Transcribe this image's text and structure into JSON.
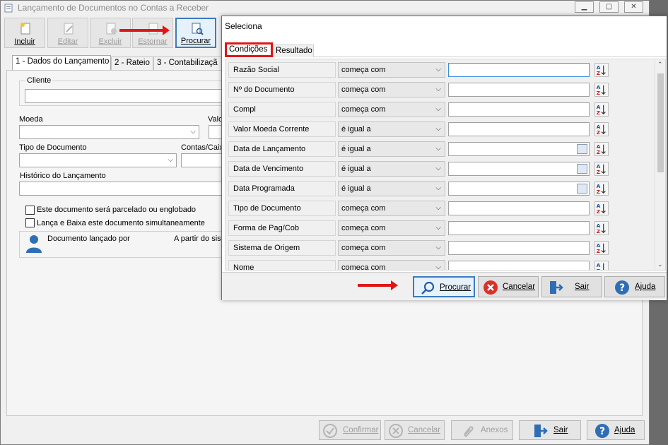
{
  "main_window": {
    "title": "Lançamento de Documentos no Contas a Receber",
    "toolbar": [
      {
        "label": "Incluir",
        "icon": "new-document-icon",
        "enabled": true
      },
      {
        "label": "Editar",
        "icon": "edit-document-icon",
        "enabled": false
      },
      {
        "label": "Excluir",
        "icon": "delete-document-icon",
        "enabled": false
      },
      {
        "label": "Estornar",
        "icon": "reverse-document-icon",
        "enabled": false
      },
      {
        "label": "Procurar",
        "icon": "search-document-icon",
        "enabled": true
      }
    ],
    "tabs": [
      "1 - Dados do Lançamento",
      "2 - Rateio",
      "3 - Contabilizaçã"
    ],
    "form": {
      "cliente_label": "Cliente",
      "moeda_label": "Moeda",
      "valor_label": "Valo",
      "tipo_documento_label": "Tipo de Documento",
      "contas_label": "Contas/Caix",
      "historico_label": "Histórico do Lançamento",
      "checkbox_parcelado": "Este documento será parcelado ou englobado",
      "checkbox_lanca_baixa": "Lança e Baixa este documento simultaneamente",
      "lancado_por_label": "Documento lançado por",
      "a_partir_label": "A partir do sis"
    },
    "bottom_buttons": [
      {
        "label": "Confirmar",
        "icon": "check-circle-icon",
        "enabled": false
      },
      {
        "label": "Cancelar",
        "icon": "cancel-circle-icon",
        "enabled": false
      },
      {
        "label": "Anexos",
        "icon": "paperclip-icon",
        "enabled": false
      },
      {
        "label": "Sair",
        "icon": "exit-door-icon",
        "enabled": true
      },
      {
        "label": "Ajuda",
        "icon": "help-circle-icon",
        "enabled": true
      }
    ]
  },
  "dialog": {
    "title": "Seleciona",
    "tabs": [
      "Condições",
      "Resultado"
    ],
    "selected_tab": "Condições",
    "conditions": [
      {
        "field": "Razão Social",
        "operator": "começa com",
        "value": "",
        "date": false
      },
      {
        "field": "Nº do Documento",
        "operator": "começa com",
        "value": "",
        "date": false
      },
      {
        "field": "Compl",
        "operator": "começa com",
        "value": "",
        "date": false
      },
      {
        "field": "Valor Moeda Corrente",
        "operator": "é igual a",
        "value": "",
        "date": false
      },
      {
        "field": "Data de Lançamento",
        "operator": "é igual a",
        "value": "",
        "date": true
      },
      {
        "field": "Data de Vencimento",
        "operator": "é igual a",
        "value": "",
        "date": true
      },
      {
        "field": "Data Programada",
        "operator": "é igual a",
        "value": "",
        "date": true
      },
      {
        "field": "Tipo de Documento",
        "operator": "começa com",
        "value": "",
        "date": false
      },
      {
        "field": "Forma de Pag/Cob",
        "operator": "começa com",
        "value": "",
        "date": false
      },
      {
        "field": "Sistema de Origem",
        "operator": "começa com",
        "value": "",
        "date": false
      },
      {
        "field": "Nome",
        "operator": "começa com",
        "value": "",
        "date": false
      }
    ],
    "buttons": [
      {
        "label": "Procurar",
        "icon": "search-icon"
      },
      {
        "label": "Cancelar",
        "icon": "cancel-circle-icon"
      },
      {
        "label": "Sair",
        "icon": "exit-door-icon"
      },
      {
        "label": "Ajuda",
        "icon": "help-circle-icon"
      }
    ]
  },
  "colors": {
    "highlight_red": "#e01616",
    "accent_blue": "#3b7bbf",
    "user_icon": "#2f6eb5"
  }
}
